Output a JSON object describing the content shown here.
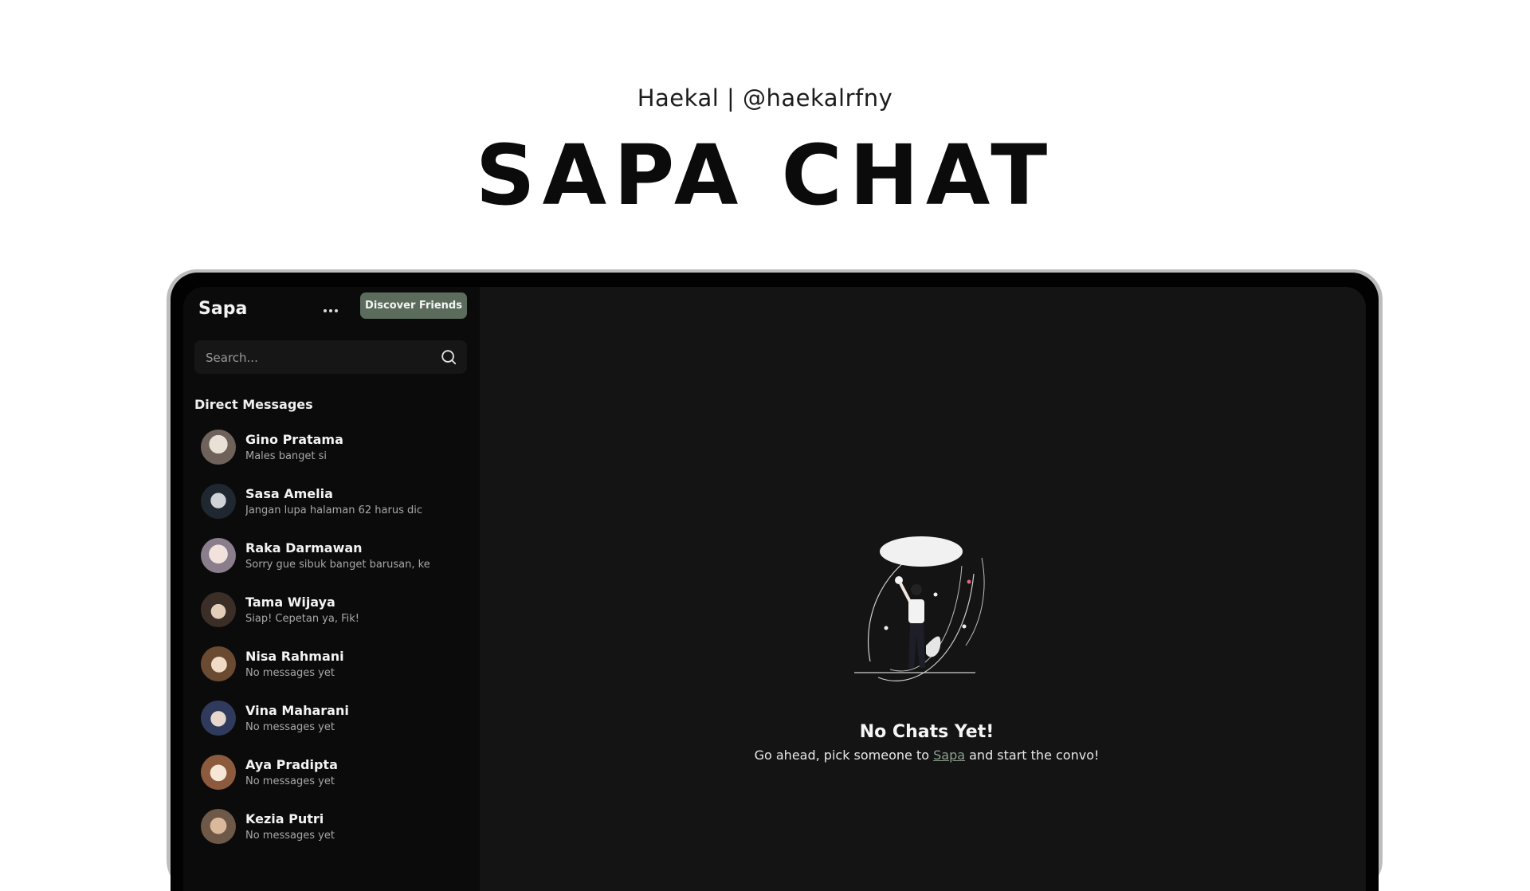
{
  "header": {
    "byline": "Haekal | @haekalrfny",
    "headline": "SAPA CHAT"
  },
  "app": {
    "title": "Sapa",
    "discover_label": "Discover Friends",
    "search_placeholder": "Search...",
    "section_label": "Direct Messages",
    "accent_color": "#5b6c5d"
  },
  "contacts": [
    {
      "name": "Gino Pratama",
      "preview": "Males banget si"
    },
    {
      "name": "Sasa Amelia",
      "preview": "Jangan lupa halaman 62 harus dic"
    },
    {
      "name": "Raka Darmawan",
      "preview": "Sorry gue sibuk banget barusan, ke"
    },
    {
      "name": "Tama Wijaya",
      "preview": "Siap! Cepetan ya, Fik!"
    },
    {
      "name": "Nisa Rahmani",
      "preview": "No messages yet"
    },
    {
      "name": "Vina Maharani",
      "preview": "No messages yet"
    },
    {
      "name": "Aya Pradipta",
      "preview": "No messages yet"
    },
    {
      "name": "Kezia Putri",
      "preview": "No messages yet"
    }
  ],
  "empty_state": {
    "title": "No Chats Yet!",
    "text_before": "Go ahead, pick someone to ",
    "link": "Sapa",
    "text_after": " and start the convo!"
  }
}
